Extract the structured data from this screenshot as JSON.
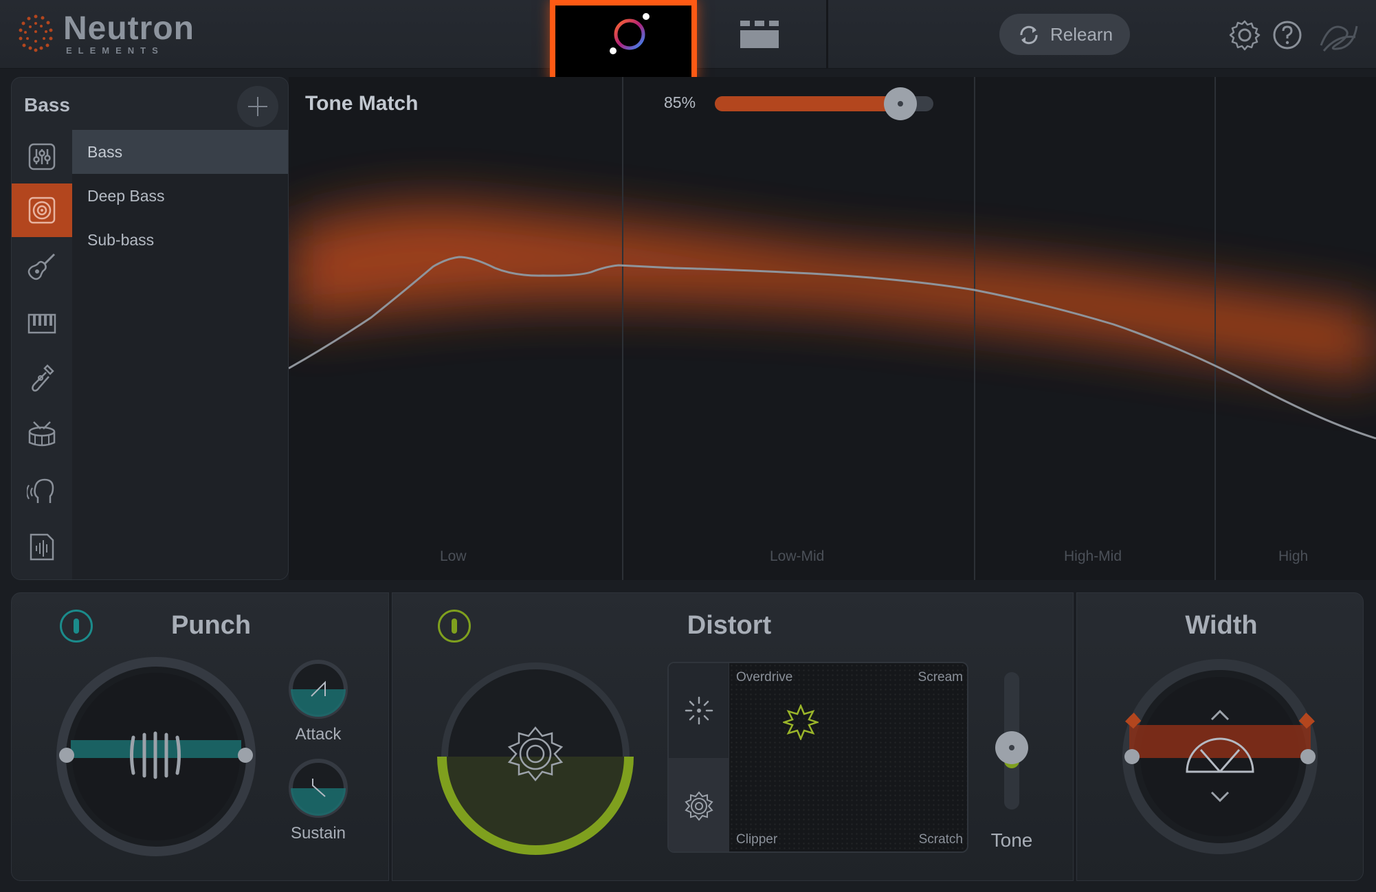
{
  "header": {
    "brand": "Neutron",
    "brand_sub": "ELEMENTS",
    "relearn_label": "Relearn",
    "assistant_icon": "assistant-orb-icon",
    "mixer_icon": "mixer-grid-icon",
    "settings_icon": "gear-icon",
    "help_icon": "help-icon",
    "logo_icon": "izotope-logo-icon"
  },
  "instrument_panel": {
    "title": "Bass",
    "categories": [
      {
        "name": "general-mixer-icon",
        "active": false
      },
      {
        "name": "speaker-bass-icon",
        "active": true
      },
      {
        "name": "guitar-icon",
        "active": false
      },
      {
        "name": "piano-keys-icon",
        "active": false
      },
      {
        "name": "brass-icon",
        "active": false
      },
      {
        "name": "drum-icon",
        "active": false
      },
      {
        "name": "voice-icon",
        "active": false
      },
      {
        "name": "audio-file-icon",
        "active": false
      }
    ],
    "presets": [
      {
        "label": "Bass",
        "selected": true
      },
      {
        "label": "Deep Bass",
        "selected": false
      },
      {
        "label": "Sub-bass",
        "selected": false
      }
    ]
  },
  "tone_match": {
    "title": "Tone Match",
    "amount_label": "85%",
    "amount": 0.85,
    "bands": [
      "Low",
      "Low-Mid",
      "High-Mid",
      "High"
    ],
    "accent": "#b3461e"
  },
  "punch": {
    "title": "Punch",
    "attack_label": "Attack",
    "sustain_label": "Sustain",
    "color": "#1b8b8b"
  },
  "distort": {
    "title": "Distort",
    "corners": {
      "top_left": "Overdrive",
      "top_right": "Scream",
      "bottom_left": "Clipper",
      "bottom_right": "Scratch"
    },
    "tone_label": "Tone",
    "tone_value": 0.45,
    "color": "#7fa01e"
  },
  "width": {
    "title": "Width",
    "color": "#b3461e"
  }
}
